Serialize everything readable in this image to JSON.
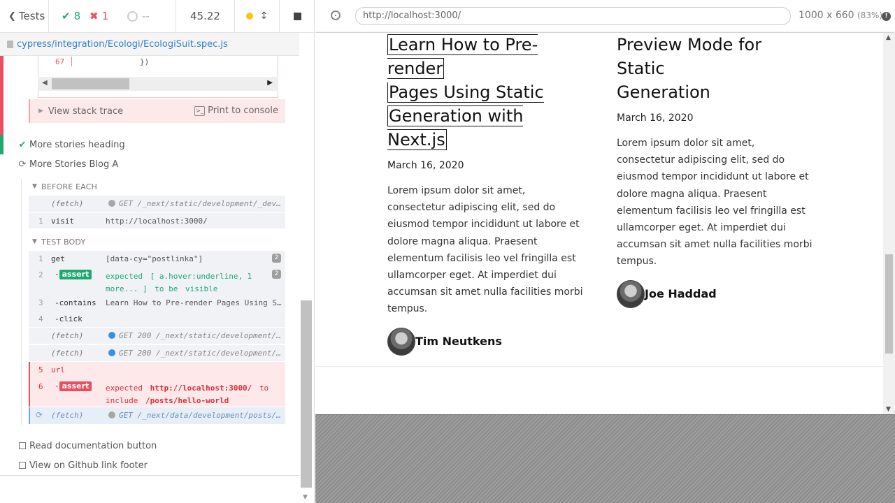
{
  "stats": {
    "tests_label": "Tests",
    "passed": "8",
    "failed": "1",
    "pending": "--",
    "duration": "45.22"
  },
  "spec_path": "cypress/integration/Ecologi/EcologiSuit.spec.js",
  "error": {
    "code_line_number": "67",
    "code_text": "})",
    "stack_trace_label": "View stack trace",
    "print_label": "Print to console"
  },
  "tests": [
    {
      "title": "More stories heading",
      "state": "passed"
    },
    {
      "title": "More Stories Blog A",
      "state": "running"
    },
    {
      "title": "Read documentation button",
      "state": "pending"
    },
    {
      "title": "View on Github link footer",
      "state": "pending"
    }
  ],
  "before_each": {
    "label": "BEFORE EACH",
    "commands": [
      {
        "num": "",
        "name": "(fetch)",
        "msg": "GET /_next/static/development/_dev…",
        "dot": "gray"
      },
      {
        "num": "1",
        "name": "visit",
        "msg": "http://localhost:3000/"
      }
    ]
  },
  "test_body": {
    "label": "TEST BODY",
    "commands": [
      {
        "num": "1",
        "name": "get",
        "msg": "[data-cy=\"postlinka\"]",
        "badge": "2"
      },
      {
        "num": "2",
        "name": "-",
        "tag": "assert",
        "msg_parts": [
          "expected",
          "[ a.hover:underline, 1",
          "more... ]",
          "to be",
          "visible"
        ],
        "badge": "2"
      },
      {
        "num": "3",
        "name": "-contains",
        "msg": "Learn How to Pre-render Pages Using S…"
      },
      {
        "num": "4",
        "name": "-click",
        "msg": ""
      },
      {
        "num": "",
        "name": "(fetch)",
        "msg": "GET 200 /_next/static/development/…",
        "dot": "blue"
      },
      {
        "num": "",
        "name": "(fetch)",
        "msg": "GET 200 /_next/static/development/…",
        "dot": "blue"
      },
      {
        "num": "5",
        "name": "url",
        "msg": ""
      },
      {
        "num": "6",
        "name": "-",
        "tag": "assert",
        "msg_parts": [
          "expected",
          "http://localhost:3000/",
          "to",
          "include",
          "/posts/hello-world"
        ]
      },
      {
        "num": "",
        "name": "(fetch)",
        "msg": "GET /_next/data/development/posts/…",
        "dot": "gray"
      }
    ]
  },
  "aut": {
    "url": "http://localhost:3000/",
    "viewport": "1000 x 660",
    "scale": "(83%)",
    "posts": [
      {
        "title_lines": [
          "Learn How to Pre-render",
          "Pages Using Static",
          "Generation with Next.js"
        ],
        "date": "March 16, 2020",
        "excerpt": "Lorem ipsum dolor sit amet, consectetur adipiscing elit, sed do eiusmod tempor incididunt ut labore et dolore magna aliqua. Praesent elementum facilisis leo vel fringilla est ullamcorper eget. At imperdiet dui accumsan sit amet nulla facilities morbi tempus.",
        "author": "Tim Neutkens"
      },
      {
        "title_lines": [
          "Preview Mode for Static",
          "Generation"
        ],
        "date": "March 16, 2020",
        "excerpt": "Lorem ipsum dolor sit amet, consectetur adipiscing elit, sed do eiusmod tempor incididunt ut labore et dolore magna aliqua. Praesent elementum facilisis leo vel fringilla est ullamcorper eget. At imperdiet dui accumsan sit amet nulla facilities morbi tempus.",
        "author": "Joe Haddad"
      }
    ]
  },
  "colors": {
    "pass": "#1fa971",
    "fail": "#e94f5f",
    "link": "#3380cc",
    "running": "#f5c518"
  }
}
